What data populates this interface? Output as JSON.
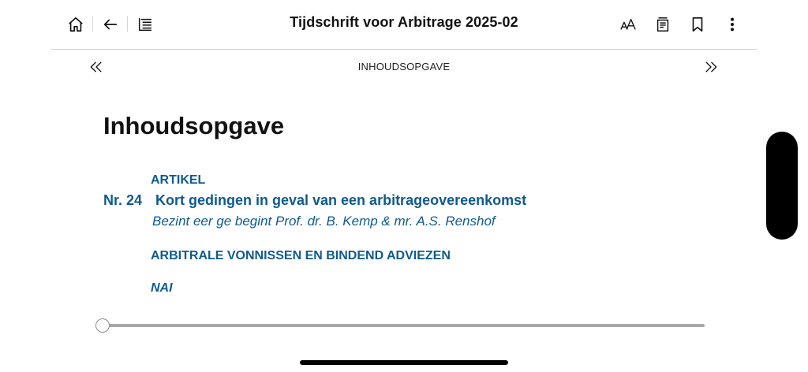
{
  "header": {
    "title": "Tijdschrift voor Arbitrage 2025-02",
    "icons": {
      "home": "home-icon",
      "back": "arrow-left-icon",
      "toc": "table-of-contents-icon",
      "font_size": "font-size-icon",
      "notes": "notes-icon",
      "bookmark": "bookmark-icon",
      "more": "more-vertical-icon"
    }
  },
  "pager": {
    "label": "INHOUDSOPGAVE",
    "prev_icon": "chevrons-left-icon",
    "next_icon": "chevrons-right-icon"
  },
  "content": {
    "heading": "Inhoudsopgave",
    "section1_label": "ARTIKEL",
    "entry": {
      "number": "Nr. 24",
      "title": "Kort gedingen in geval van een arbitrageovereenkomst",
      "subtitle": "Bezint eer ge begint Prof. dr. B. Kemp & mr. A.S. Renshof"
    },
    "section2_label": "ARBITRALE VONNISSEN EN BINDEND ADVIEZEN",
    "section3_label": "NAI"
  },
  "progress": {
    "value_fraction": 0.0
  },
  "colors": {
    "accent": "#0f5a8e",
    "track": "#a8a8a8"
  }
}
